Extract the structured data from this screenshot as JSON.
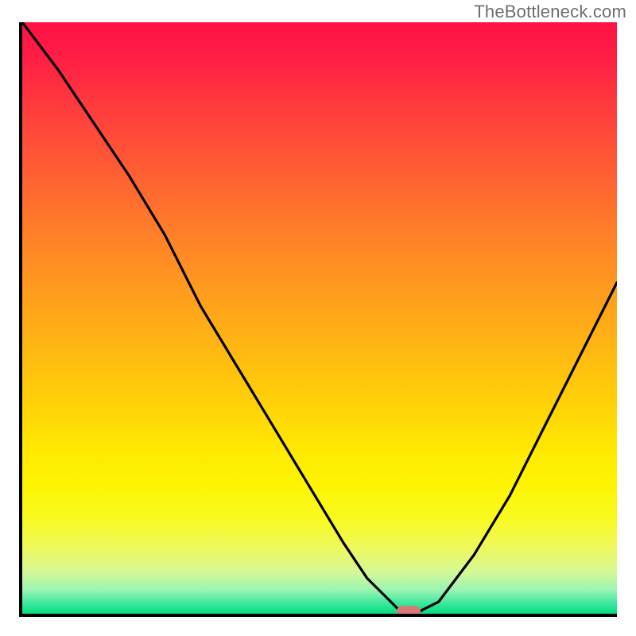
{
  "watermark": "TheBottleneck.com",
  "chart_data": {
    "type": "line",
    "title": "",
    "xlabel": "",
    "ylabel": "",
    "xlim": [
      0,
      100
    ],
    "ylim": [
      0,
      100
    ],
    "grid": false,
    "legend": false,
    "series": [
      {
        "name": "bottleneck-curve",
        "x": [
          0,
          6,
          12,
          18,
          24,
          30,
          36,
          42,
          48,
          54,
          58,
          62,
          64,
          66,
          70,
          76,
          82,
          88,
          94,
          100
        ],
        "y": [
          100,
          92,
          83,
          74,
          64,
          52,
          42,
          32,
          22,
          12,
          6,
          2,
          0,
          0,
          2,
          10,
          20,
          32,
          44,
          56
        ]
      }
    ],
    "marker": {
      "name": "optimal-point",
      "x": 65,
      "y": 0,
      "color": "#d67a78"
    },
    "background_gradient": {
      "top": "#ff1244",
      "upper_mid": "#ff9820",
      "mid": "#ffe802",
      "lower_mid": "#eef860",
      "bottom": "#08da7e"
    }
  }
}
